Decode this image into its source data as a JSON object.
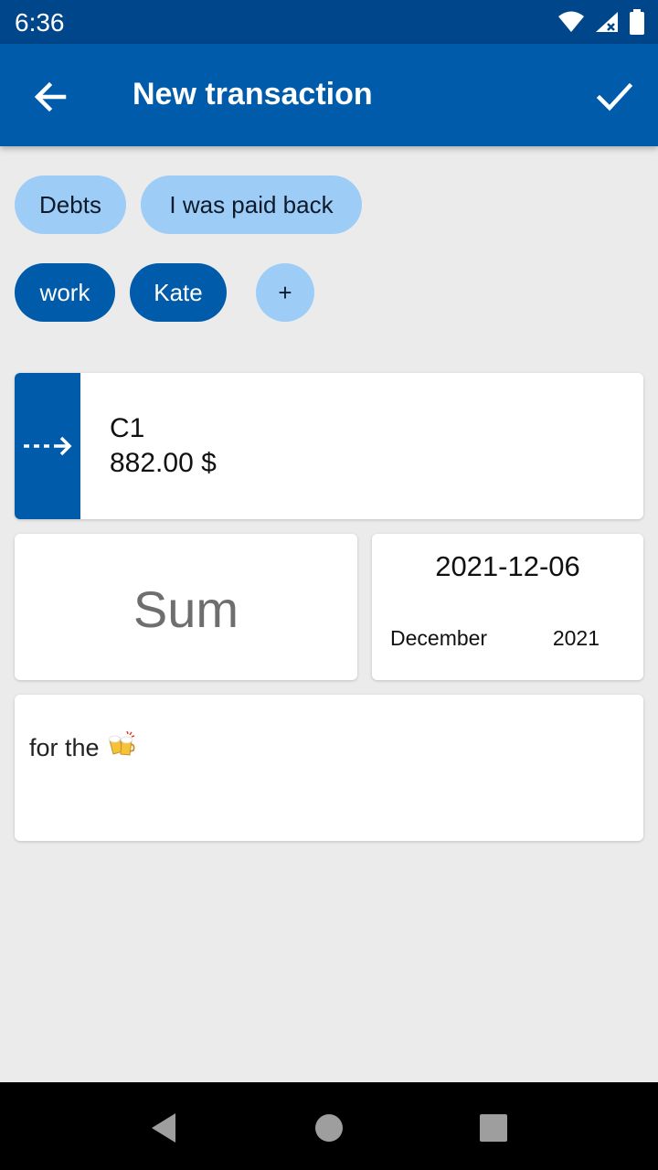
{
  "status_bar": {
    "time": "6:36"
  },
  "app_bar": {
    "title": "New transaction",
    "back_icon": "arrow-back-icon",
    "confirm_icon": "check-icon"
  },
  "category_chips": [
    {
      "label": "Debts"
    },
    {
      "label": "I was paid back"
    }
  ],
  "tag_chips": [
    {
      "label": "work"
    },
    {
      "label": "Kate"
    },
    {
      "label": "+"
    }
  ],
  "account": {
    "name": "C1",
    "balance": "882.00 $",
    "icon": "dashed-arrow-right-icon"
  },
  "sum": {
    "placeholder": "Sum"
  },
  "date": {
    "value": "2021-12-06",
    "month": "December",
    "year": "2021"
  },
  "note": {
    "text": "for the",
    "emoji_icon": "clinking-beer-mugs-icon"
  },
  "colors": {
    "primary": "#005BAA",
    "primary_dark": "#00468A",
    "chip_light": "#9DCDF7",
    "background": "#EBEBEB"
  }
}
